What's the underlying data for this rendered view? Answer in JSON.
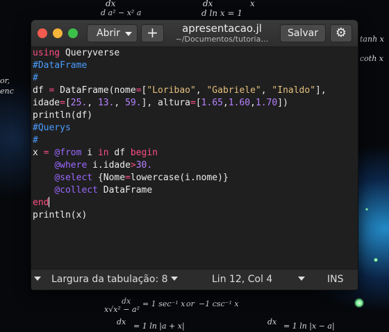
{
  "window": {
    "title": "apresentacao.jl",
    "subtitle": "~/Documentos/tutoria…",
    "open_label": "Abrir",
    "new_label": "+",
    "save_label": "Salvar",
    "settings_icon": "gear-icon"
  },
  "editor": {
    "lines": [
      "using Queryverse",
      "#DataFrame",
      "#",
      "df = DataFrame(nome=[\"Loribao\", \"Gabriele\", \"Inaldo\"],",
      "idade=[25., 13., 59.], altura=[1.65,1.60,1.70])",
      "println(df)",
      "#Querys",
      "#",
      "x = @from i in df begin",
      "    @where i.idade>30.",
      "    @select {Nome=lowercase(i.nome)}",
      "    @collect DataFrame",
      "end",
      "println(x)"
    ],
    "colors": {
      "keyword": "#ff4f84",
      "comment": "#4a9cff",
      "string": "#e4c07d",
      "number": "#b782ff",
      "macro": "#9a68ff"
    }
  },
  "statusbar": {
    "tab_width": "Largura da tabulação: 8",
    "position": "Lin 12, Col 4",
    "mode": "INS"
  },
  "background_math": {
    "top_left_a": "dx",
    "top_left_b": "d  a² − x²  a",
    "top_center_a": "dx",
    "top_center_b": "d ln x = 1",
    "top_center_c": "x",
    "right_1": "tanh x",
    "right_2": "coth x",
    "left_1": "or,",
    "left_2": "enc",
    "bottom_1_lhs": "dx",
    "bottom_1_rhs": "= 1 sec⁻¹ x",
    "bottom_1_or": "or",
    "bottom_1_alt": "−1 csc⁻¹ x",
    "bottom_1_den": "x√x² − a²",
    "bottom_2_lhs": "dx",
    "bottom_2_rhs": "= 1 ln |a + x|",
    "bottom_3_lhs": "dx",
    "bottom_3_rhs": "= 1 ln |x − a|"
  }
}
